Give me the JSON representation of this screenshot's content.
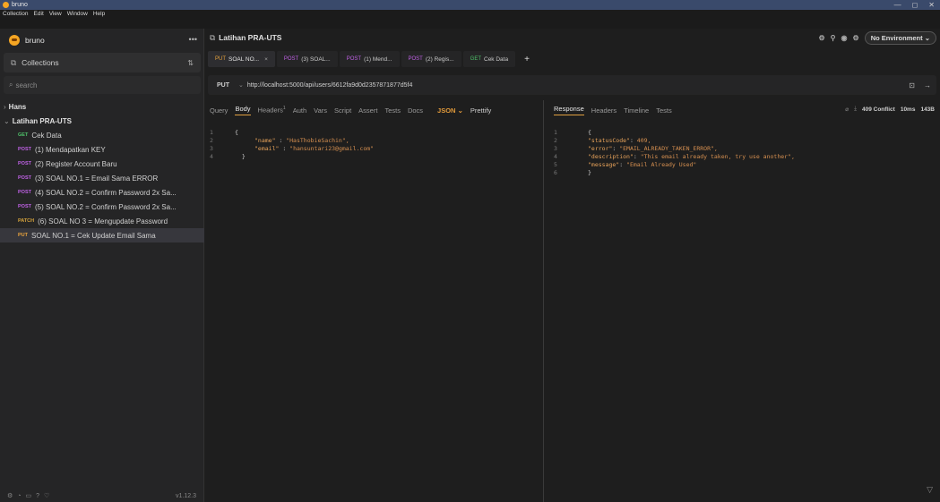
{
  "window": {
    "title": "bruno",
    "controls": [
      "—",
      "◻",
      "✕"
    ]
  },
  "menu": [
    "Collection",
    "Edit",
    "View",
    "Window",
    "Help"
  ],
  "sidebar": {
    "app_name": "bruno",
    "more": "•••",
    "collections_label": "Collections",
    "sort_icon": "⇅",
    "search_placeholder": "search",
    "collections": [
      {
        "name": "Hans",
        "open": false
      },
      {
        "name": "Latihan PRA-UTS",
        "open": true
      }
    ],
    "requests": [
      {
        "method": "GET",
        "name": "Cek Data"
      },
      {
        "method": "POST",
        "name": "(1) Mendapatkan KEY"
      },
      {
        "method": "POST",
        "name": "(2) Register Account Baru"
      },
      {
        "method": "POST",
        "name": "(3) SOAL NO.1 = Email Sama ERROR"
      },
      {
        "method": "POST",
        "name": "(4) SOAL NO.2 = Confirm Password 2x Sa..."
      },
      {
        "method": "POST",
        "name": "(5) SOAL NO.2 = Confirm Password 2x Sa..."
      },
      {
        "method": "PATCH",
        "name": "(6) SOAL NO 3 = Mengupdate Password"
      },
      {
        "method": "PUT",
        "name": "SOAL NO.1 = Cek Update Email Sama"
      }
    ],
    "footer_version": "v1.12.3"
  },
  "main": {
    "collection_title": "Latihan PRA-UTS",
    "environment": "No Environment",
    "tabs": [
      {
        "method": "PUT",
        "label": "SOAL NO...",
        "closable": true,
        "active": true
      },
      {
        "method": "POST",
        "label": "(3) SOAL...",
        "closable": false,
        "active": false
      },
      {
        "method": "POST",
        "label": "(1) Mend...",
        "closable": false,
        "active": false
      },
      {
        "method": "POST",
        "label": "(2) Regis...",
        "closable": false,
        "active": false
      },
      {
        "method": "GET",
        "label": "Cek Data",
        "closable": false,
        "active": false
      }
    ],
    "request": {
      "method": "PUT",
      "url": "http://localhost:5000/api/users/6612fa9d0d2357871877d5f4"
    },
    "req_tabs": [
      "Query",
      "Body",
      "Headers",
      "Auth",
      "Vars",
      "Script",
      "Assert",
      "Tests",
      "Docs"
    ],
    "req_tab_headers_count": "1",
    "body_mode": "JSON",
    "prettify": "Prettify",
    "body_lines": [
      {
        "n": "1",
        "text": "{"
      },
      {
        "n": "2",
        "key": "\"name\"",
        "sep": " : ",
        "val": "\"HasThobieSachin\","
      },
      {
        "n": "3",
        "key": "\"email\"",
        "sep": " : ",
        "val": "\"hansuntari23@gmail.com\""
      },
      {
        "n": "4",
        "text": "  }"
      }
    ],
    "res_tabs": [
      "Response",
      "Headers",
      "Timeline",
      "Tests"
    ],
    "response_status": "409 Conflict",
    "response_time": "10ms",
    "response_size": "143B",
    "response_lines": [
      {
        "n": "1",
        "text": "{"
      },
      {
        "n": "2",
        "key": "\"statusCode\"",
        "sep": ": ",
        "val": "409,"
      },
      {
        "n": "3",
        "key": "\"error\"",
        "sep": ": ",
        "val": "\"EMAIL_ALREADY_TAKEN_ERROR\","
      },
      {
        "n": "4",
        "key": "\"description\"",
        "sep": ": ",
        "val": "\"This email already taken, try use another\","
      },
      {
        "n": "5",
        "key": "\"message\"",
        "sep": ": ",
        "val": "\"Email Already Used\""
      },
      {
        "n": "6",
        "text": "}"
      }
    ]
  }
}
